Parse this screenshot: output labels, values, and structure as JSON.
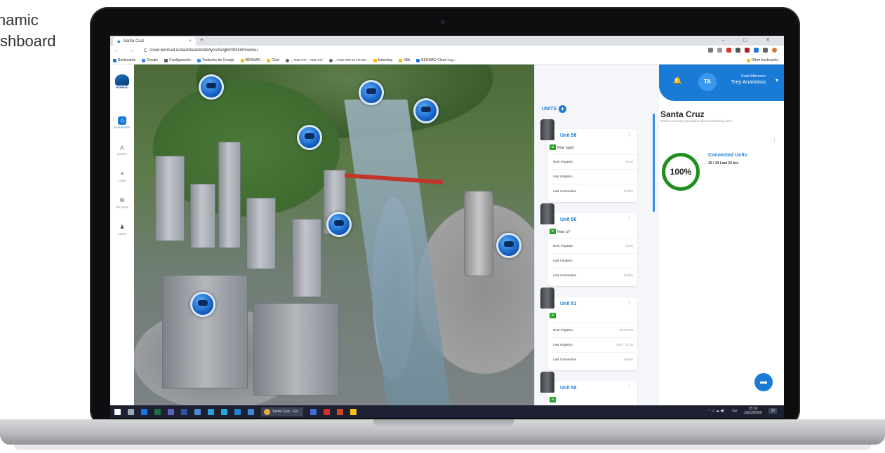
{
  "caption": {
    "line1": "namic",
    "line2": "shboard"
  },
  "browser": {
    "tab_title": "Santa Cruz",
    "tab_close": "×",
    "new_tab": "+",
    "window_controls": "–  ▢  ✕",
    "nav": "← → C",
    "url": "cloud.bermad.io/dashboard/ckb4yrcc5zqjlm0934ih0rwnwu",
    "bookmarks": [
      {
        "label": "Bookmarks",
        "color": "#1a73e8"
      },
      {
        "label": "Google",
        "color": "#4285f4"
      },
      {
        "label": "Configuración",
        "color": "#5f6368"
      },
      {
        "label": "Traductor de Google",
        "color": "#4285f4"
      },
      {
        "label": "BERMAD",
        "color": "#f4c20d"
      },
      {
        "label": "Chat",
        "color": "#f4c20d"
      },
      {
        "label": "...דוח עובד - דוח עבוד",
        "color": "#5f6368"
      },
      {
        "label": "...הצהרת בריאות עובד",
        "color": "#5f6368"
      },
      {
        "label": "Intrecting",
        "color": "#f4c20d"
      },
      {
        "label": "JBA",
        "color": "#f4c20d"
      },
      {
        "label": "BERMAD Cloud Log...",
        "color": "#1a73e8"
      }
    ],
    "other_bookmarks": "Other bookmarks"
  },
  "sidenav": {
    "logo": "BERMAD",
    "items": [
      {
        "label": "DASHBOARD",
        "icon": "home-icon",
        "glyph": "⌂"
      },
      {
        "label": "ALERTS",
        "icon": "bell-icon",
        "glyph": "🔔"
      },
      {
        "label": "LOGS",
        "icon": "list-icon",
        "glyph": "≡"
      },
      {
        "label": "SETTINGS",
        "icon": "gear-icon",
        "glyph": "⚙"
      },
      {
        "label": "USERS",
        "icon": "users-icon",
        "glyph": "👥"
      }
    ]
  },
  "units_panel": {
    "heading": "UNITS",
    "add": "+",
    "cards": [
      {
        "title": "Unit 58",
        "now": "Now: ppp2",
        "rows": [
          {
            "label": "Next Irrigation",
            "value": "Soon"
          },
          {
            "label": "Last Irrigation",
            "value": ""
          },
          {
            "label": "Last Connection",
            "value": "Online"
          }
        ]
      },
      {
        "title": "Unit 56",
        "now": "Now: p7",
        "rows": [
          {
            "label": "Next Irrigation",
            "value": "Soon"
          },
          {
            "label": "Last Irrigation",
            "value": ""
          },
          {
            "label": "Last Connection",
            "value": "Online"
          }
        ]
      },
      {
        "title": "Unit 51",
        "now": "",
        "rows": [
          {
            "label": "Next Irrigation",
            "value": "03:35 PM"
          },
          {
            "label": "Last Irrigation",
            "value": "Last - 11:25"
          },
          {
            "label": "Last Connection",
            "value": "Online"
          }
        ]
      },
      {
        "title": "Unit 55",
        "now": "",
        "rows": []
      }
    ]
  },
  "header": {
    "avatar": "TA",
    "greeting": "Good Afternoon",
    "user": "Trey Anastasio",
    "chevron": "⌄"
  },
  "site": {
    "title": "Santa Cruz",
    "description": "Santa Cruz long description about something desc",
    "widget": {
      "title": "Connected Units",
      "subtitle": "10 / 10 Last 24 hrs",
      "percent": "100%"
    }
  },
  "taskbar": {
    "active_app": "Santa Cruz - Go...",
    "lang": "עבר",
    "time": "15:16",
    "date": "15/12/2020",
    "notifications": "25"
  },
  "colors": {
    "accent": "#1a7bd6",
    "ok": "#1f8f1f"
  }
}
